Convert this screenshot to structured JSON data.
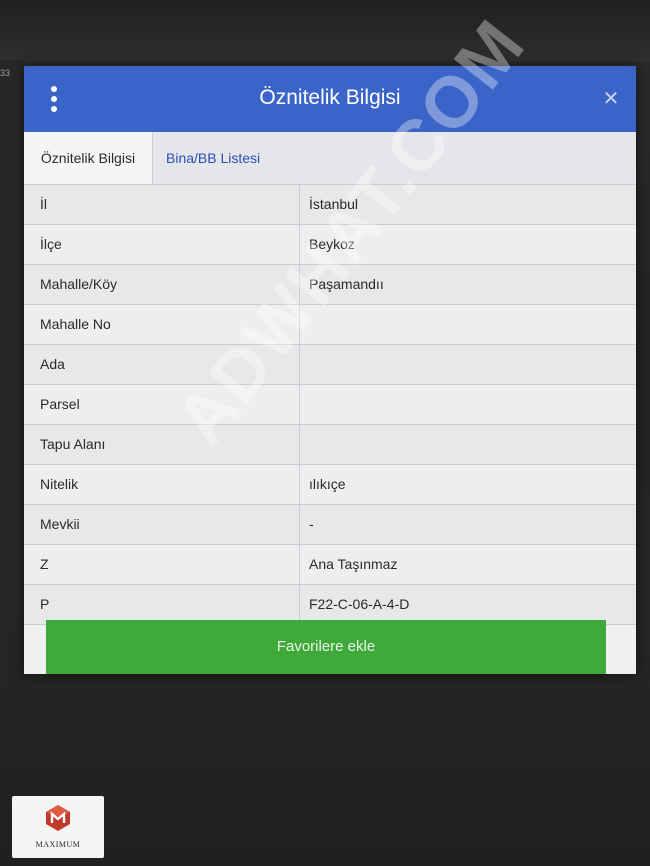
{
  "background": {
    "page_fragment": "33"
  },
  "dialog": {
    "title": "Öznitelik Bilgisi",
    "menu_icon": "vertical-dots-icon",
    "close_icon": "close-icon",
    "close_glyph": "✕",
    "header_color": "#3a64c8",
    "tabs": [
      {
        "label": "Öznitelik Bilgisi",
        "active": true
      },
      {
        "label": "Bina/BB Listesi",
        "active": false
      }
    ],
    "rows": [
      {
        "key": "İl",
        "value": "İstanbul"
      },
      {
        "key": "İlçe",
        "value": "Beykoz"
      },
      {
        "key": "Mahalle/Köy",
        "value": "Paşamandıı"
      },
      {
        "key": "Mahalle No",
        "value": ""
      },
      {
        "key": "Ada",
        "value": ""
      },
      {
        "key": "Parsel",
        "value": ""
      },
      {
        "key": "Tapu Alanı",
        "value": ""
      },
      {
        "key": "Nitelik",
        "value": "ılıkıçe"
      },
      {
        "key": "Mevkii",
        "value": "-"
      },
      {
        "key": "Z",
        "value": "Ana Taşınmaz"
      },
      {
        "key": "P",
        "value": "F22-C-06-A-4-D"
      }
    ],
    "favorite_button_label": "Favorilere ekle",
    "favorite_button_color": "#3faa3a"
  },
  "watermark": {
    "text": "ADWHAT.COM"
  },
  "logo": {
    "name": "MAXIMUM",
    "mark_color": "#c0392b"
  }
}
